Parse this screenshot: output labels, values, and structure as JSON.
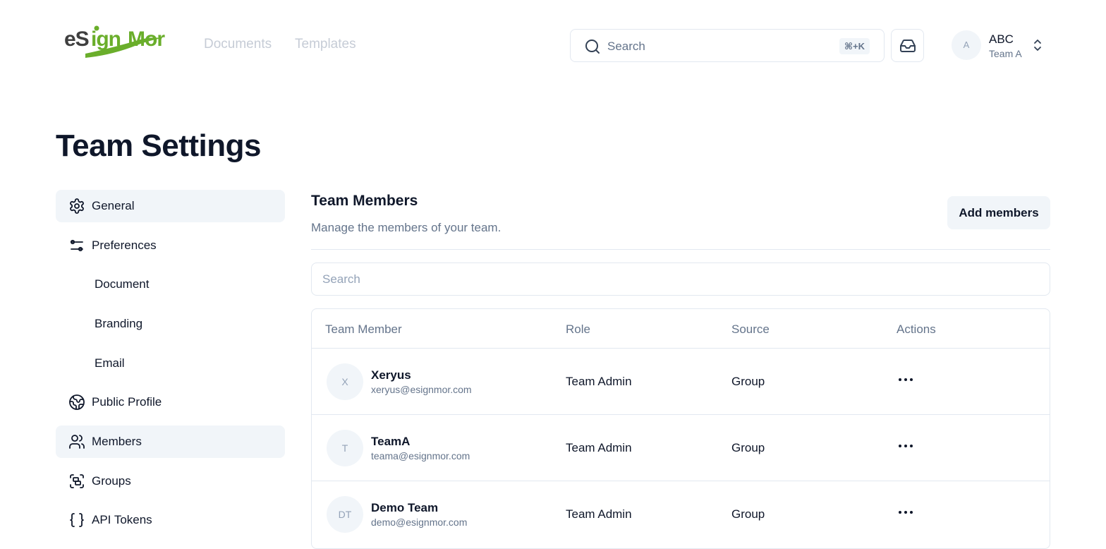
{
  "header": {
    "logo_text": "eSignMor",
    "nav": [
      {
        "label": "Documents"
      },
      {
        "label": "Templates"
      }
    ],
    "search": {
      "label": "Search",
      "shortcut": "⌘+K"
    },
    "account": {
      "avatar_initial": "A",
      "name": "ABC",
      "team": "Team A"
    }
  },
  "page": {
    "title": "Team Settings"
  },
  "sidebar": {
    "items": [
      {
        "label": "General",
        "icon": "gear-icon",
        "active": true
      },
      {
        "label": "Preferences",
        "icon": "sliders-icon",
        "active": false
      },
      {
        "label": "Document",
        "sub": true
      },
      {
        "label": "Branding",
        "sub": true
      },
      {
        "label": "Email",
        "sub": true
      },
      {
        "label": "Public Profile",
        "icon": "globe-icon",
        "active": false
      },
      {
        "label": "Members",
        "icon": "users-icon",
        "active": true
      },
      {
        "label": "Groups",
        "icon": "groups-icon",
        "active": false
      },
      {
        "label": "API Tokens",
        "icon": "braces-icon",
        "active": false
      }
    ]
  },
  "members": {
    "title": "Team Members",
    "description": "Manage the members of your team.",
    "add_button": "Add members",
    "search_placeholder": "Search",
    "columns": [
      "Team Member",
      "Role",
      "Source",
      "Actions"
    ],
    "rows": [
      {
        "initials": "X",
        "name": "Xeryus",
        "email": "xeryus@esignmor.com",
        "role": "Team Admin",
        "source": "Group"
      },
      {
        "initials": "T",
        "name": "TeamA",
        "email": "teama@esignmor.com",
        "role": "Team Admin",
        "source": "Group"
      },
      {
        "initials": "DT",
        "name": "Demo Team",
        "email": "demo@esignmor.com",
        "role": "Team Admin",
        "source": "Group"
      }
    ]
  },
  "colors": {
    "brand_dark": "#3f3f3f",
    "brand_green": "#6aae2b",
    "muted_text": "#64748b",
    "active_bg": "#f1f5f9",
    "border": "#e2e8f0"
  }
}
